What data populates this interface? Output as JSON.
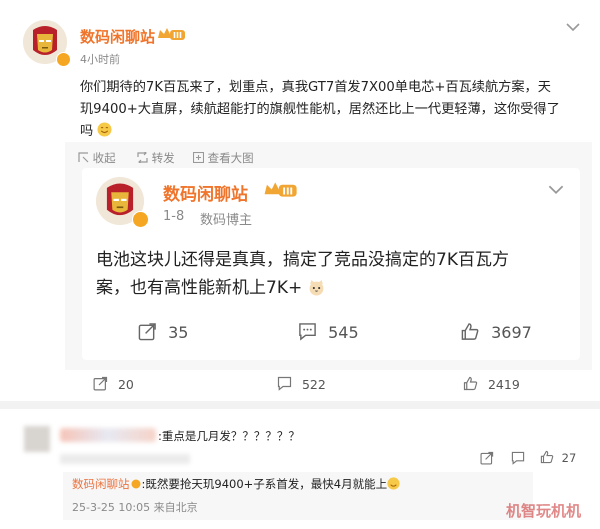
{
  "post": {
    "author": "数码闲聊站",
    "level": "III",
    "time": "4小时前",
    "text_line1": "你们期待的7K百瓦来了，划重点，真我GT7首发7X00单电芯+百瓦续航方案，天",
    "text_line2": "玑9400+大直屏，续航超能打的旗舰性能机，居然还比上一代更轻薄，这你受得了",
    "text_line3": "吗",
    "actions": {
      "collect": "收起",
      "repost": "转发",
      "view_large": "查看大图"
    }
  },
  "quoted": {
    "author": "数码闲聊站",
    "level": "III",
    "date": "1-8",
    "role": "数码博主",
    "text_line1": "电池这块儿还得是真真，搞定了竞品没搞定的7K百瓦方",
    "text_line2": "案，也有高性能新机上7K+",
    "reposts": "35",
    "comments": "545",
    "likes": "3697"
  },
  "stats": {
    "reposts": "20",
    "comments": "522",
    "likes": "2419"
  },
  "comments": {
    "first_text": ":重点是几月发？？？？？？",
    "first_likes": "27",
    "reply_author": "数码闲聊站",
    "reply_text": ":既然要抢天玑9400+子系首发，最快4月就能上",
    "reply_meta": "25-3-25 10:05 来自北京"
  },
  "watermark": "机智玩机机",
  "colors": {
    "accent": "#f0752c",
    "muted": "#8a8a8a",
    "link": "#eb7340",
    "quote_bg": "#f7f7f7"
  }
}
